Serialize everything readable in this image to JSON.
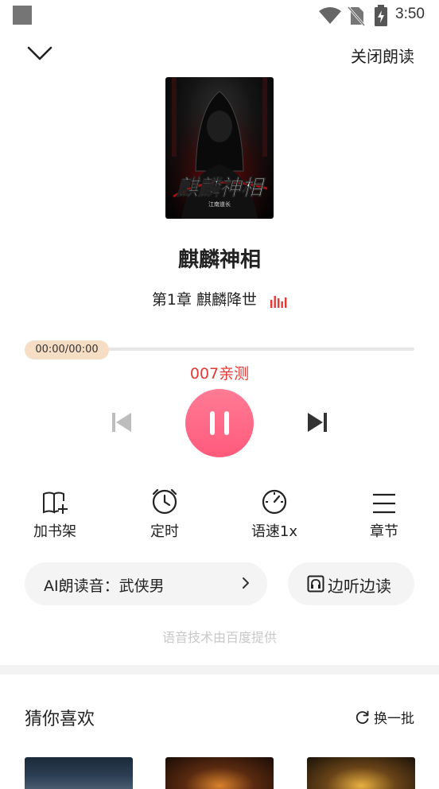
{
  "status_bar": {
    "time": "3:50"
  },
  "header": {
    "close_label": "关闭朗读"
  },
  "book": {
    "title": "麒麟神相",
    "cover_title": "麒麟神相",
    "cover_author": "江南道长",
    "chapter": "第1章 麒麟降世"
  },
  "player": {
    "time": "00:00/00:00",
    "progress": 0,
    "voice": "007亲测"
  },
  "tools": [
    {
      "label": "加书架",
      "icon": "add-bookshelf-icon"
    },
    {
      "label": "定时",
      "icon": "alarm-clock-icon"
    },
    {
      "label": "语速1x",
      "icon": "speedometer-icon"
    },
    {
      "label": "章节",
      "icon": "menu-lines-icon"
    }
  ],
  "ai_voice": {
    "label": "AI朗读音：武侠男"
  },
  "listen_read": {
    "label": "边听边读"
  },
  "provider_note": "语音技术由百度提供",
  "recommend": {
    "title": "猜你喜欢",
    "refresh_label": "换一批"
  },
  "colors": {
    "accent": "#ff5a7b",
    "voice_red": "#e53935",
    "pill": "#f6dec4"
  }
}
